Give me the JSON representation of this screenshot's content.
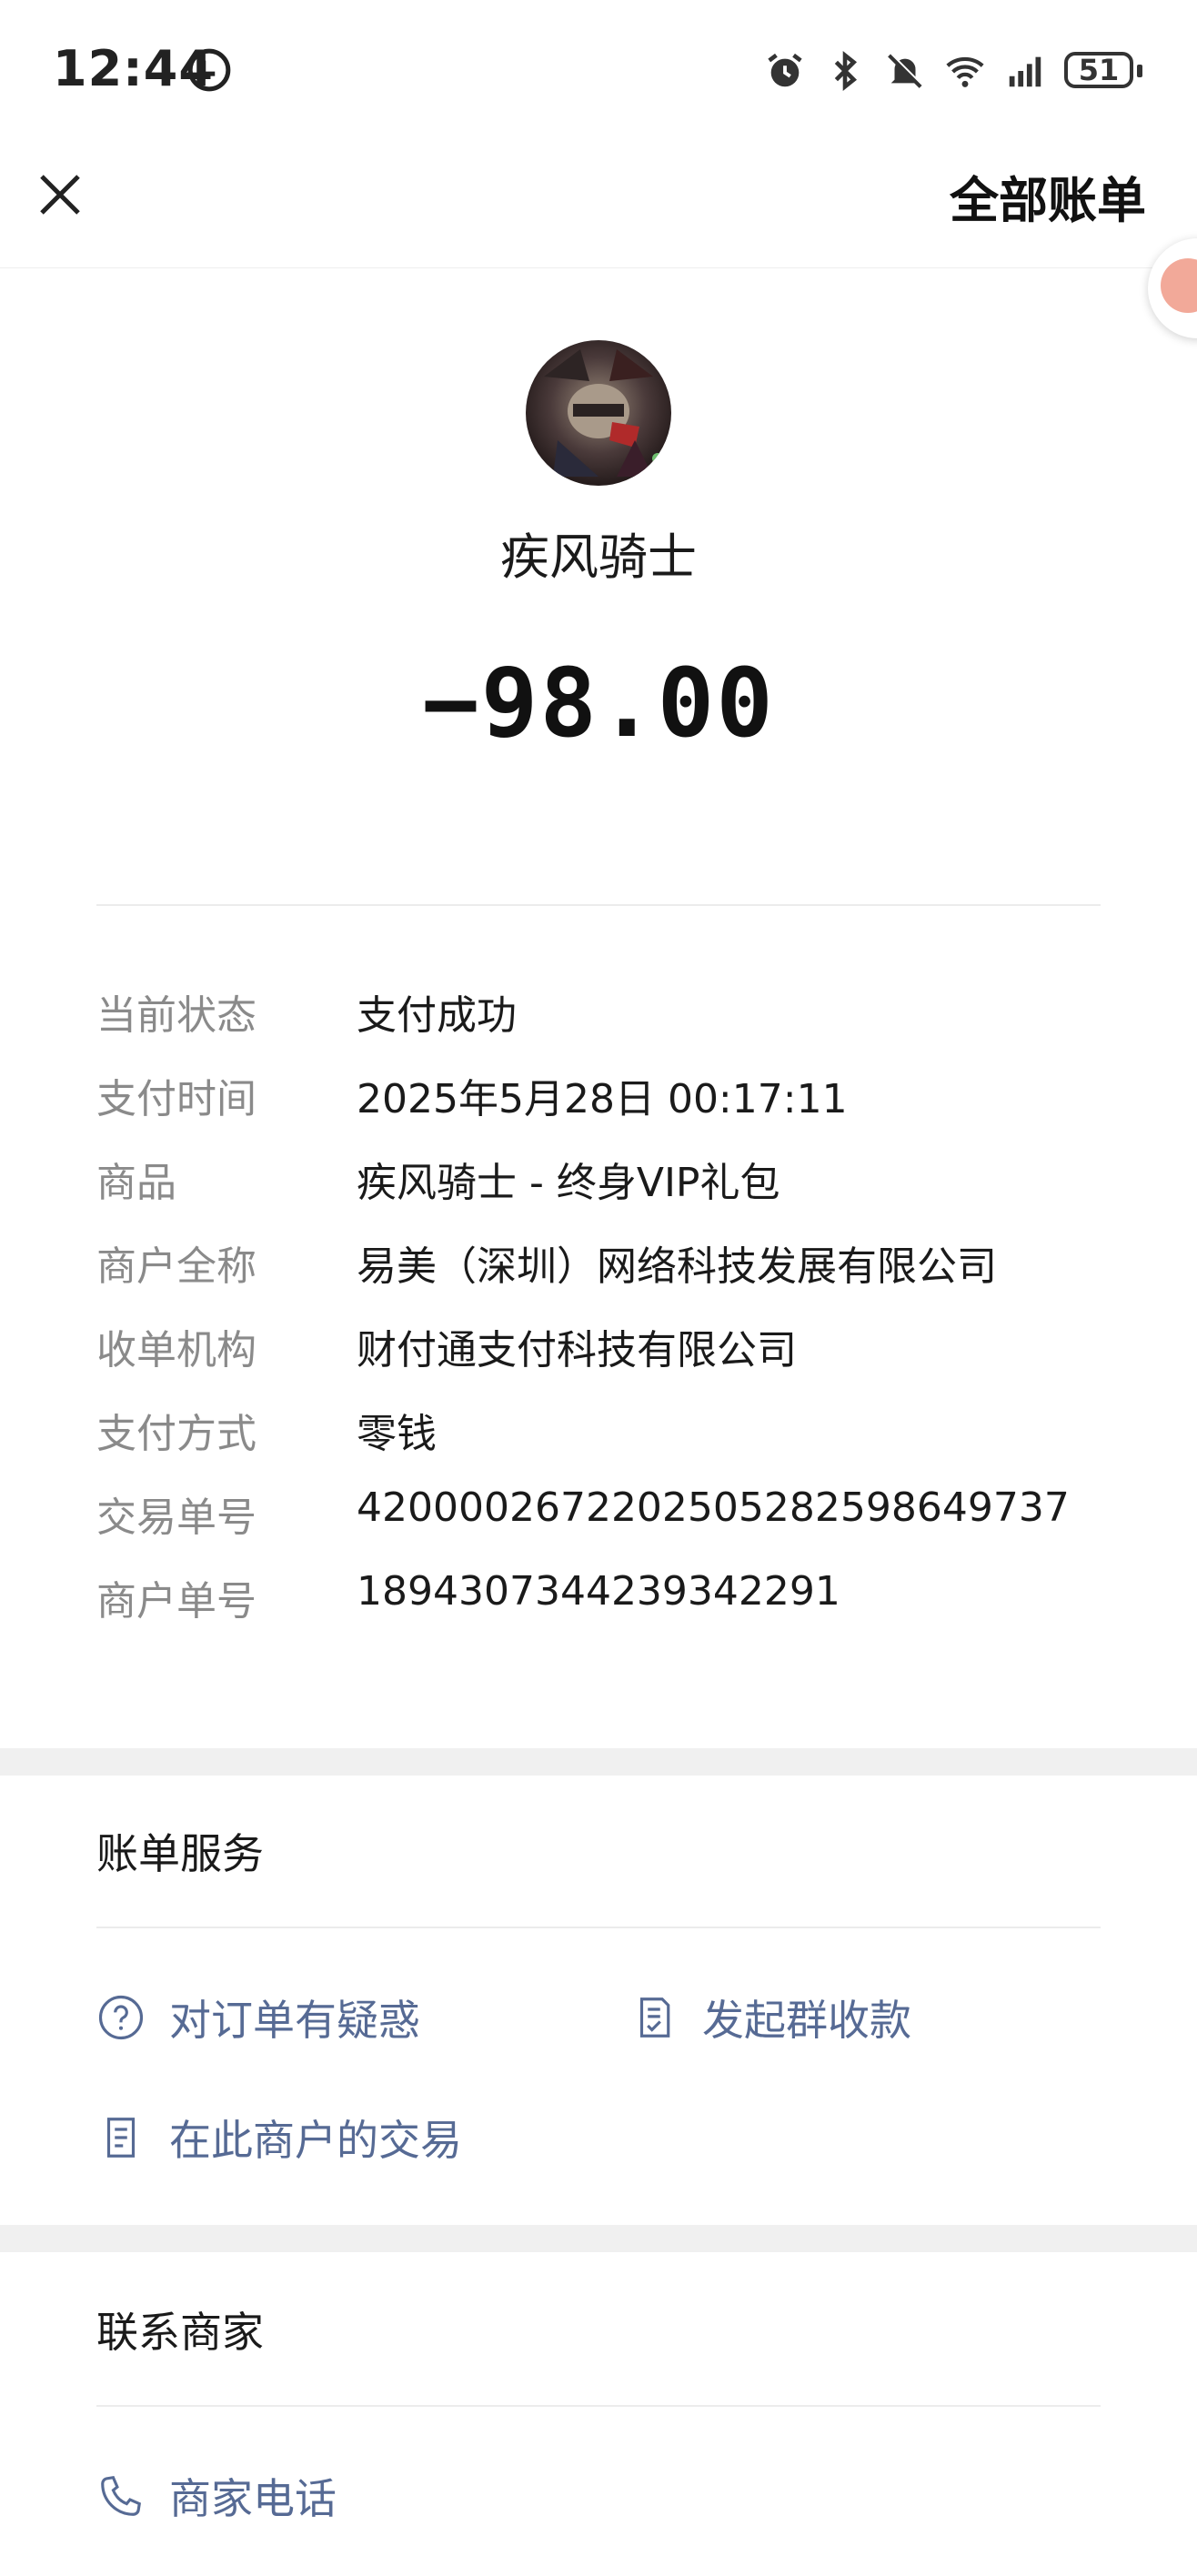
{
  "status_bar": {
    "time": "12:44",
    "battery": "51"
  },
  "nav": {
    "title": "全部账单"
  },
  "header": {
    "merchant_name": "疾风骑士",
    "amount": "−98.00"
  },
  "details": [
    {
      "label": "当前状态",
      "value": "支付成功"
    },
    {
      "label": "支付时间",
      "value": "2025年5月28日 00:17:11"
    },
    {
      "label": "商品",
      "value": "疾风骑士 - 终身VIP礼包"
    },
    {
      "label": "商户全称",
      "value": "易美（深圳）网络科技发展有限公司"
    },
    {
      "label": "收单机构",
      "value": "财付通支付科技有限公司"
    },
    {
      "label": "支付方式",
      "value": "零钱"
    },
    {
      "label": "交易单号",
      "value": "4200002672202505282598649737"
    },
    {
      "label": "商户单号",
      "value": "1894307344239342291"
    }
  ],
  "bill_service": {
    "title": "账单服务",
    "question_order": "对订单有疑惑",
    "group_collect": "发起群收款",
    "merchant_transactions": "在此商户的交易"
  },
  "contact_merchant": {
    "title": "联系商家",
    "merchant_phone": "商家电话"
  },
  "colors": {
    "link": "#566a94",
    "label": "#8a8a8a",
    "band": "#f0f0f0"
  }
}
